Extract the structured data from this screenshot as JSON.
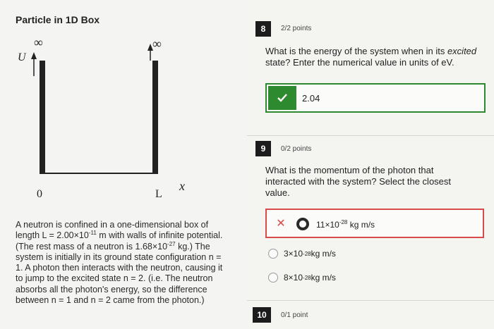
{
  "left": {
    "title": "Particle in 1D Box",
    "diagram": {
      "u_label": "U",
      "infinity_left": "∞",
      "infinity_right": "∞",
      "zero_label": "0",
      "l_label": "L",
      "x_label": "x"
    },
    "problem": {
      "p1": "A neutron is confined in a one-dimensional box of length L = 2.00×10",
      "p1_exp": "-11",
      "p2": " m with walls of infinite potential. (The rest mass of a neutron is 1.68×10",
      "p2_exp": "-27",
      "p3": " kg.) The system is initially in its ground state configuration n = 1. A photon then interacts with the neutron, causing it to jump to the excited state n = 2. (i.e. The neutron absorbs all the photon's energy, so the difference between n = 1 and n = 2 came from the photon.)"
    }
  },
  "questions": [
    {
      "number": "8",
      "points": "2/2 points",
      "text_a": "What is the energy of the system when in its ",
      "text_em": "excited",
      "text_b": " state? Enter the numerical value in units of eV.",
      "answer": "2.04"
    },
    {
      "number": "9",
      "points": "0/2 points",
      "text": "What is the momentum of the photon that interacted with the system? Select the closest value.",
      "options": [
        {
          "base": "11×10",
          "exp": "-28",
          "unit": " kg m/s",
          "selected": true
        },
        {
          "base": "3×10",
          "exp": "-28",
          "unit": " kg m/s",
          "selected": false
        },
        {
          "base": "8×10",
          "exp": "-28",
          "unit": " kg m/s",
          "selected": false
        }
      ]
    },
    {
      "number": "10",
      "points": "0/1 point"
    }
  ],
  "colors": {
    "correct": "#2e8a2e",
    "incorrect": "#d94a4a"
  }
}
